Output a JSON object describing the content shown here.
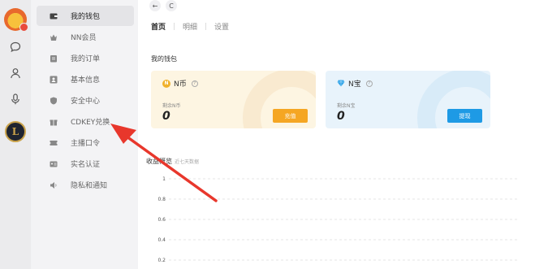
{
  "menu": {
    "items": [
      {
        "label": "我的钱包",
        "icon": "wallet-icon",
        "active": true
      },
      {
        "label": "NN会员",
        "icon": "member-icon",
        "active": false
      },
      {
        "label": "我的订单",
        "icon": "order-icon",
        "active": false
      },
      {
        "label": "基本信息",
        "icon": "profile-card-icon",
        "active": false
      },
      {
        "label": "安全中心",
        "icon": "shield-icon",
        "active": false
      },
      {
        "label": "CDKEY兑换",
        "icon": "gift-icon",
        "active": false
      },
      {
        "label": "主播口令",
        "icon": "ticket-icon",
        "active": false
      },
      {
        "label": "实名认证",
        "icon": "id-card-icon",
        "active": false
      },
      {
        "label": "隐私和通知",
        "icon": "speaker-icon",
        "active": false
      }
    ]
  },
  "nav": {
    "back": "←",
    "refresh": "C"
  },
  "tabs": [
    {
      "label": "首页",
      "active": true
    },
    {
      "label": "明细",
      "active": false
    },
    {
      "label": "设置",
      "active": false
    }
  ],
  "wallet": {
    "title": "我的钱包",
    "ncoin": {
      "name": "N币",
      "coin_glyph": "N",
      "help": "?",
      "balance_label": "剩余N币",
      "balance": "0",
      "button": "充值"
    },
    "ntreasure": {
      "name": "N宝",
      "help": "?",
      "balance_label": "剩余N宝",
      "balance": "0",
      "button": "提现"
    }
  },
  "chart_title": {
    "main": "收益概览",
    "sub": "近七天数据"
  },
  "chart_data": {
    "type": "line",
    "y_ticks": [
      "1",
      "0.8",
      "0.6",
      "0.4",
      "0.2"
    ],
    "ylim": [
      0,
      1
    ],
    "grid": true,
    "series": []
  },
  "colors": {
    "accent_orange": "#f5a623",
    "accent_blue": "#1e9ae5",
    "annotation_red": "#e8372c"
  }
}
